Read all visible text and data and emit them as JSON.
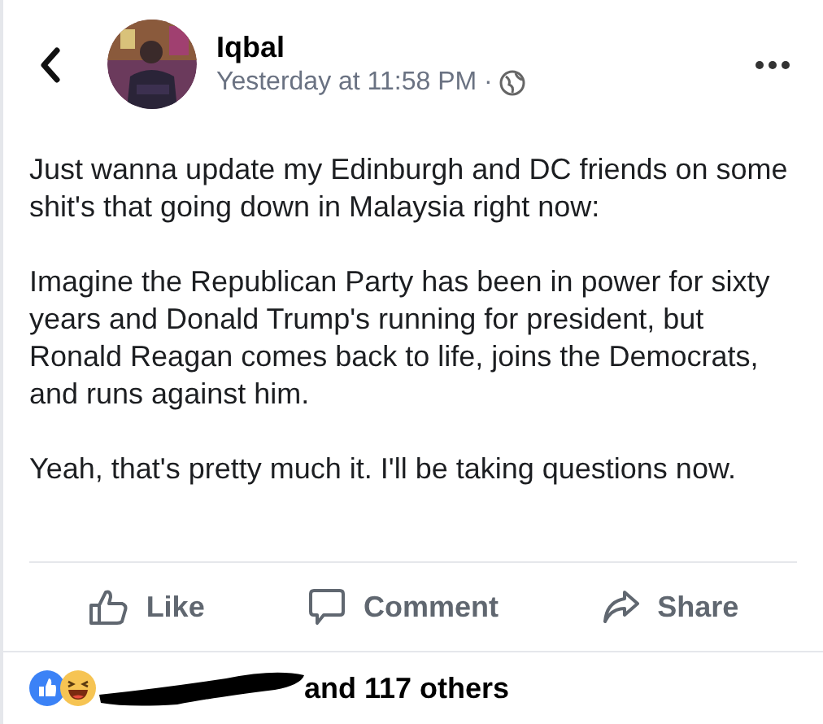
{
  "post": {
    "author": "Iqbal",
    "time": "Yesterday at 11:58 PM ·",
    "paragraphs": [
      "Just wanna update my Edinburgh and DC friends on some shit's that going down in Malaysia right now:",
      "Imagine the Republican Party has been in power for sixty years and Donald Trump's running for president, but Ronald Reagan comes back to life, joins the Democrats, and runs against him.",
      "Yeah, that's pretty much it. I'll be taking questions now."
    ]
  },
  "actions": [
    {
      "kind": "like",
      "label": "Like"
    },
    {
      "kind": "comment",
      "label": "Comment"
    },
    {
      "kind": "share",
      "label": "Share"
    }
  ],
  "reactions": {
    "summary": "and 117 others"
  }
}
